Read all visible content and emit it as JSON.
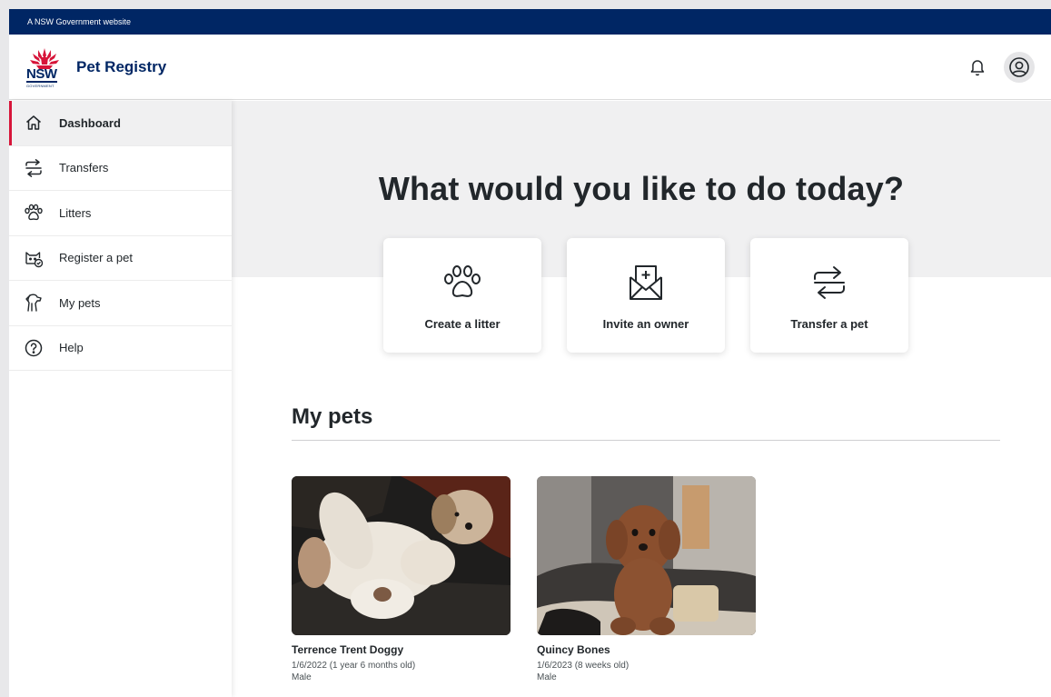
{
  "gov_bar": {
    "text": "A NSW Government website"
  },
  "header": {
    "logo": {
      "text": "NSW",
      "subtext": "GOVERNMENT"
    },
    "app_title": "Pet Registry"
  },
  "sidebar": {
    "items": [
      {
        "label": "Dashboard",
        "icon": "home-icon",
        "active": true
      },
      {
        "label": "Transfers",
        "icon": "transfer-icon"
      },
      {
        "label": "Litters",
        "icon": "paw-icon"
      },
      {
        "label": "Register a pet",
        "icon": "cat-register-icon"
      },
      {
        "label": "My pets",
        "icon": "dog-icon"
      },
      {
        "label": "Help",
        "icon": "help-icon"
      }
    ]
  },
  "hero": {
    "title": "What would you like to do today?",
    "actions": [
      {
        "label": "Create a litter",
        "icon": "paw-icon"
      },
      {
        "label": "Invite an owner",
        "icon": "envelope-plus-icon"
      },
      {
        "label": "Transfer a pet",
        "icon": "transfer-icon"
      }
    ]
  },
  "my_pets": {
    "title": "My pets",
    "pets": [
      {
        "name": "Terrence Trent Doggy",
        "dob": "1/6/2022 (1 year 6 months old)",
        "sex": "Male"
      },
      {
        "name": "Quincy Bones",
        "dob": "1/6/2023 (8 weeks old)",
        "sex": "Male"
      }
    ]
  },
  "colors": {
    "gov_blue": "#002664",
    "accent_red": "#d7153a",
    "hero_bg": "#f0f0f1"
  }
}
